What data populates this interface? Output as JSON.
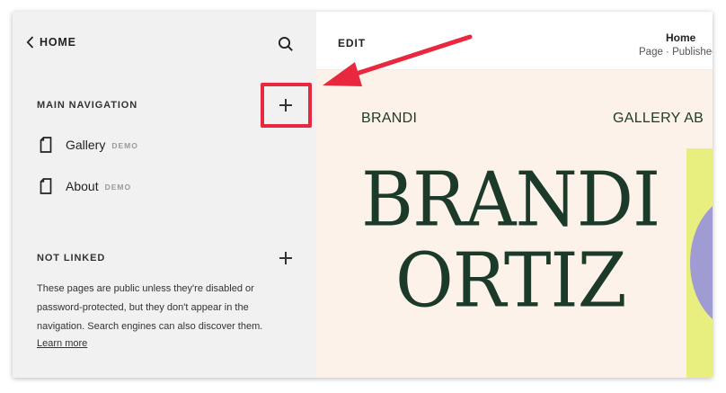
{
  "sidebar": {
    "home_label": "HOME",
    "main_navigation": {
      "title": "MAIN NAVIGATION",
      "items": [
        {
          "label": "Gallery",
          "badge": "DEMO"
        },
        {
          "label": "About",
          "badge": "DEMO"
        }
      ]
    },
    "not_linked": {
      "title": "NOT LINKED",
      "description": "These pages are public unless they're disabled or password-protected, but they don't appear in the navigation. Search engines can also discover them.",
      "learn_more": "Learn more"
    }
  },
  "preview": {
    "edit_label": "EDIT",
    "page_title": "Home",
    "page_status": "Page · Published",
    "site": {
      "brand": "BRANDI",
      "nav": "GALLERY   AB",
      "hero_line_1": "BRANDI",
      "hero_line_2": "ORTIZ"
    }
  },
  "colors": {
    "highlight": "#e8283e",
    "brand_text": "#1c3a2a",
    "preview_bg": "#fdf2ea",
    "art_yellow": "#e9ef7f",
    "art_purple": "#a19bd4"
  }
}
